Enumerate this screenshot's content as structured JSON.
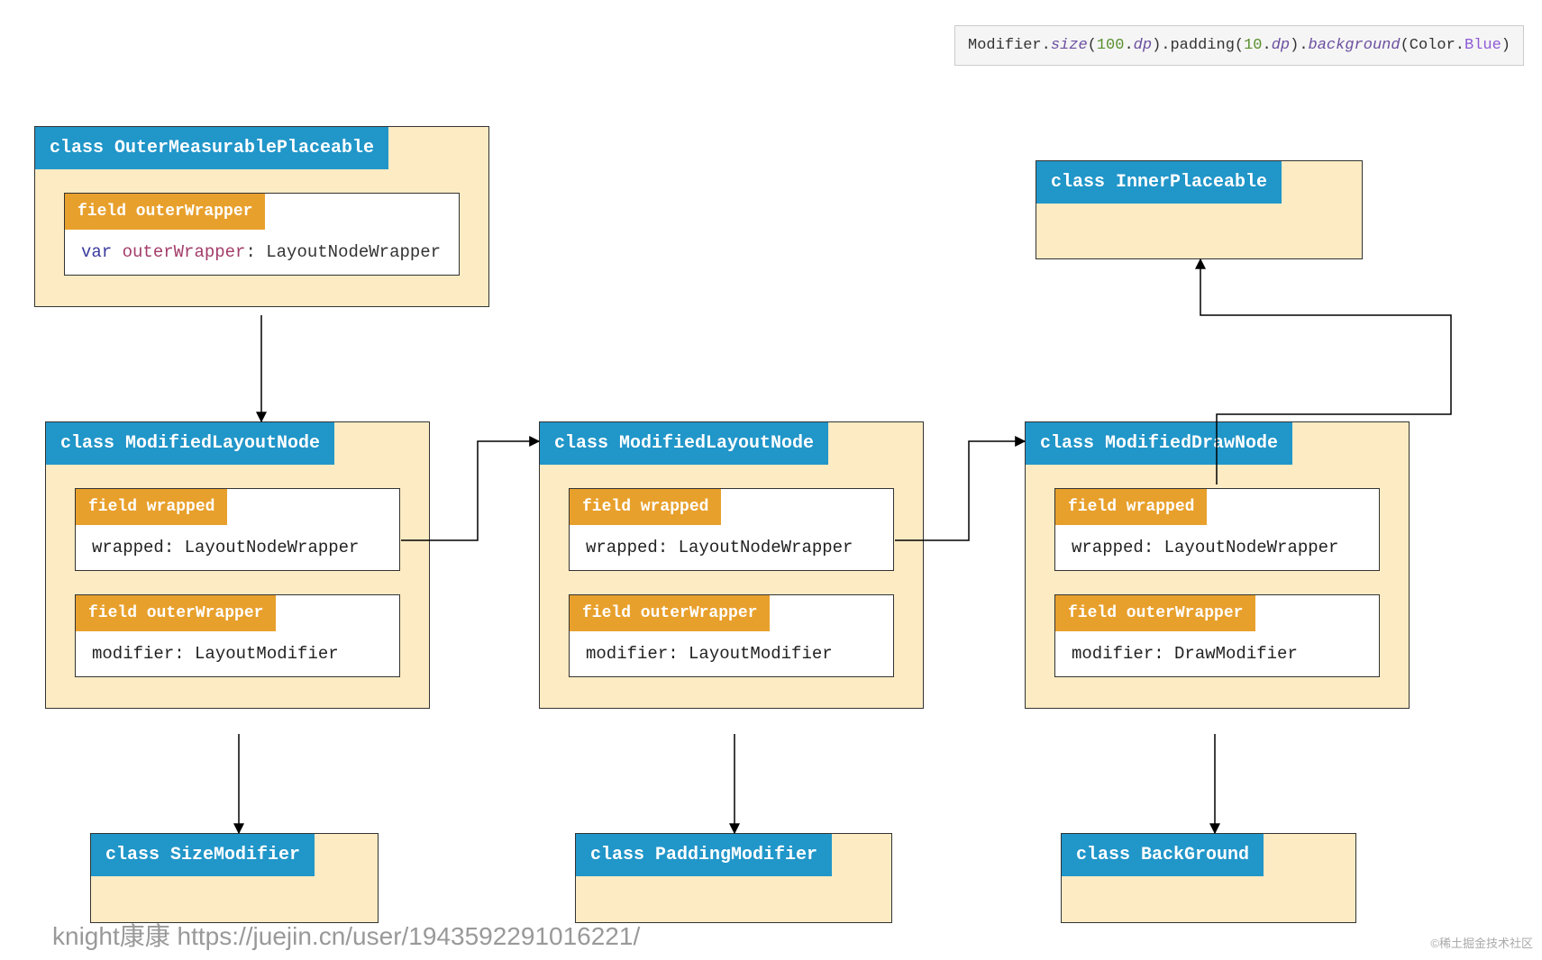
{
  "code_snippet": {
    "seg1": "Modifier.",
    "seg2": "size",
    "seg3": "(",
    "seg4": "100",
    "seg5": ".",
    "seg6": "dp",
    "seg7": ").padding(",
    "seg8": "10",
    "seg9": ".",
    "seg10": "dp",
    "seg11": ").",
    "seg12": "background",
    "seg13": "(Color.",
    "seg14": "Blue",
    "seg15": ")"
  },
  "cards": {
    "outer": {
      "title": "class OuterMeasurablePlaceable",
      "f1_title": "field outerWrapper",
      "f1_var": "var",
      "f1_name": "outerWrapper",
      "f1_rest": ": LayoutNodeWrapper"
    },
    "mln1": {
      "title": "class ModifiedLayoutNode",
      "f1_title": "field wrapped",
      "f1_body": "wrapped: LayoutNodeWrapper",
      "f2_title": "field outerWrapper",
      "f2_body": "modifier: LayoutModifier"
    },
    "mln2": {
      "title": "class ModifiedLayoutNode",
      "f1_title": "field wrapped",
      "f1_body": "wrapped: LayoutNodeWrapper",
      "f2_title": "field outerWrapper",
      "f2_body": "modifier: LayoutModifier"
    },
    "mdn": {
      "title": "class ModifiedDrawNode",
      "f1_title": "field wrapped",
      "f1_body": "wrapped: LayoutNodeWrapper",
      "f2_title": "field outerWrapper",
      "f2_body": "modifier: DrawModifier"
    },
    "inner": {
      "title": "class InnerPlaceable"
    },
    "size": {
      "title": "class SizeModifier"
    },
    "pad": {
      "title": "class PaddingModifier"
    },
    "bg": {
      "title": "class BackGround"
    }
  },
  "watermarks": {
    "left": "knight康康 https://juejin.cn/user/1943592291016221/",
    "right": "©稀土掘金技术社区"
  }
}
